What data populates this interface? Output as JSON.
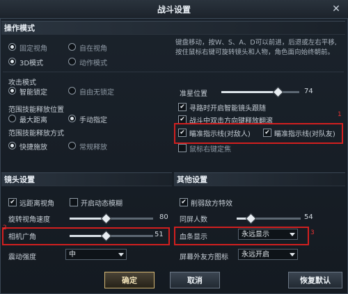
{
  "window": {
    "title": "战斗设置"
  },
  "operation": {
    "header": "操作模式",
    "radios": [
      "固定视角",
      "自在视角",
      "3D模式",
      "动作模式"
    ],
    "hint": "键盘移动，按W、S、A、D可以前进，后退或左右平移,按住鼠标右键可旋转镜头和人物，角色面向始终朝前。"
  },
  "attack": {
    "mode_label": "攻击模式",
    "mode_options": [
      "智能锁定",
      "自由无锁定"
    ],
    "pos_label": "范围技能释放位置",
    "pos_options": [
      "最大距离",
      "手动指定"
    ],
    "method_label": "范围技能释放方式",
    "method_options": [
      "快捷施放",
      "常规释放"
    ]
  },
  "aim": {
    "label": "准星位置",
    "value": "74"
  },
  "right_checks": {
    "c1": "寻路时开启智能镜头跟随",
    "c2": "战斗中双击方向键释放翻滚",
    "c3": "瞄准指示线(对敌人)",
    "c4": "瞄准指示线(对队友)",
    "c5": "鼠标右键定焦"
  },
  "camera": {
    "header": "镜头设置",
    "far_view": "远距离视角",
    "motion_blur": "开启动态模糊",
    "rotate_label": "旋转视角速度",
    "rotate_value": "80",
    "fov_label": "相机广角",
    "fov_value": "51",
    "shake_label": "震动强度",
    "shake_value": "中"
  },
  "other": {
    "header": "其他设置",
    "weaken": "削弱敌方特效",
    "same_screen_label": "同屏人数",
    "same_screen_value": "54",
    "hp_label": "血条显示",
    "hp_value": "永远显示",
    "offscreen_label": "屏幕外友方图标",
    "offscreen_value": "永远开启"
  },
  "annotations": {
    "n1": "1",
    "n2": "2",
    "n3": "3"
  },
  "buttons": {
    "ok": "确定",
    "cancel": "取消",
    "reset": "恢复默认"
  },
  "icons": {
    "close": "close-icon",
    "caret": "chevron-down-icon"
  },
  "colors": {
    "highlight": "#d31f1f",
    "bg": "#141a21"
  },
  "levels": {
    "aim": 0.74,
    "rotate": 0.8,
    "fov": 0.51,
    "same_screen": 0.54
  }
}
